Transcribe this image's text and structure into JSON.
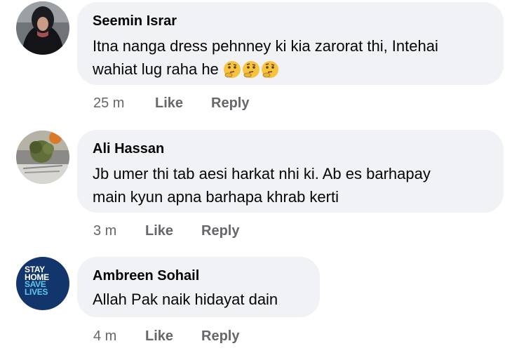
{
  "comments": [
    {
      "author": "Seemin Israr",
      "text_line1": "Itna nanga dress pehnney ki kia zarorat thi, Intehai",
      "text_line2": "wahiat lug raha he",
      "emojis": [
        "thinking-face-emoji",
        "thinking-face-emoji",
        "thinking-face-emoji"
      ],
      "time": "25 m",
      "like_label": "Like",
      "reply_label": "Reply"
    },
    {
      "author": "Ali Hassan",
      "text_line1": "Jb umer thi tab aesi harkat nhi ki. Ab es barhapay",
      "text_line2": "main kyun apna barhapa khrab kerti",
      "time": "3 m",
      "like_label": "Like",
      "reply_label": "Reply"
    },
    {
      "author": "Ambreen Sohail",
      "text_line1": "Allah Pak naik hidayat dain",
      "time": "4 m",
      "like_label": "Like",
      "reply_label": "Reply",
      "avatar_text": [
        "STAY",
        "HOME",
        "SAVE",
        "LIVES"
      ]
    }
  ],
  "colors": {
    "bubble": "#f0f2f5",
    "name": "#050505",
    "meta": "#65676b",
    "stay_home_blue": "#12356b"
  }
}
